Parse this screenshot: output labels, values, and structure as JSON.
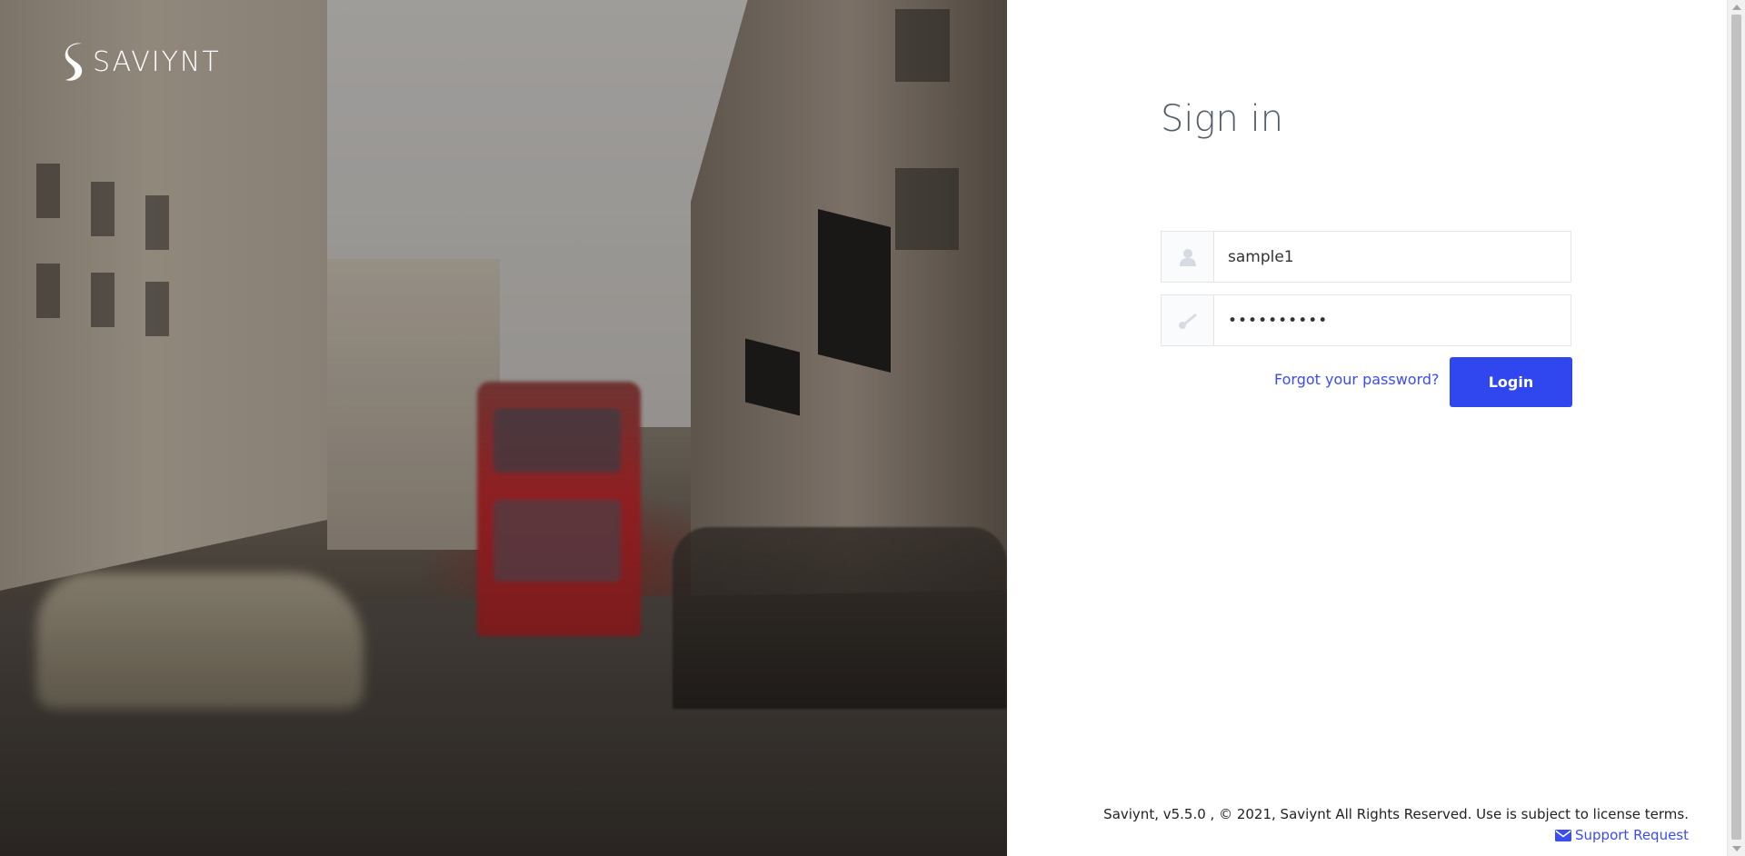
{
  "brand": {
    "name": "SAVIYNT"
  },
  "login": {
    "title": "Sign in",
    "username_value": "sample1",
    "password_masked": "••••••••••",
    "forgot_label": "Forgot your password?",
    "login_label": "Login"
  },
  "icons": {
    "username": "user-icon",
    "password": "key-icon",
    "support": "envelope-icon"
  },
  "footer": {
    "copyright": "Saviynt, v5.5.0 , © 2021, Saviynt All Rights Reserved. Use is subject to license terms.",
    "support_label": "Support Request"
  },
  "colors": {
    "accent": "#3047ef",
    "link": "#3b4cf0",
    "title": "#555d66"
  }
}
